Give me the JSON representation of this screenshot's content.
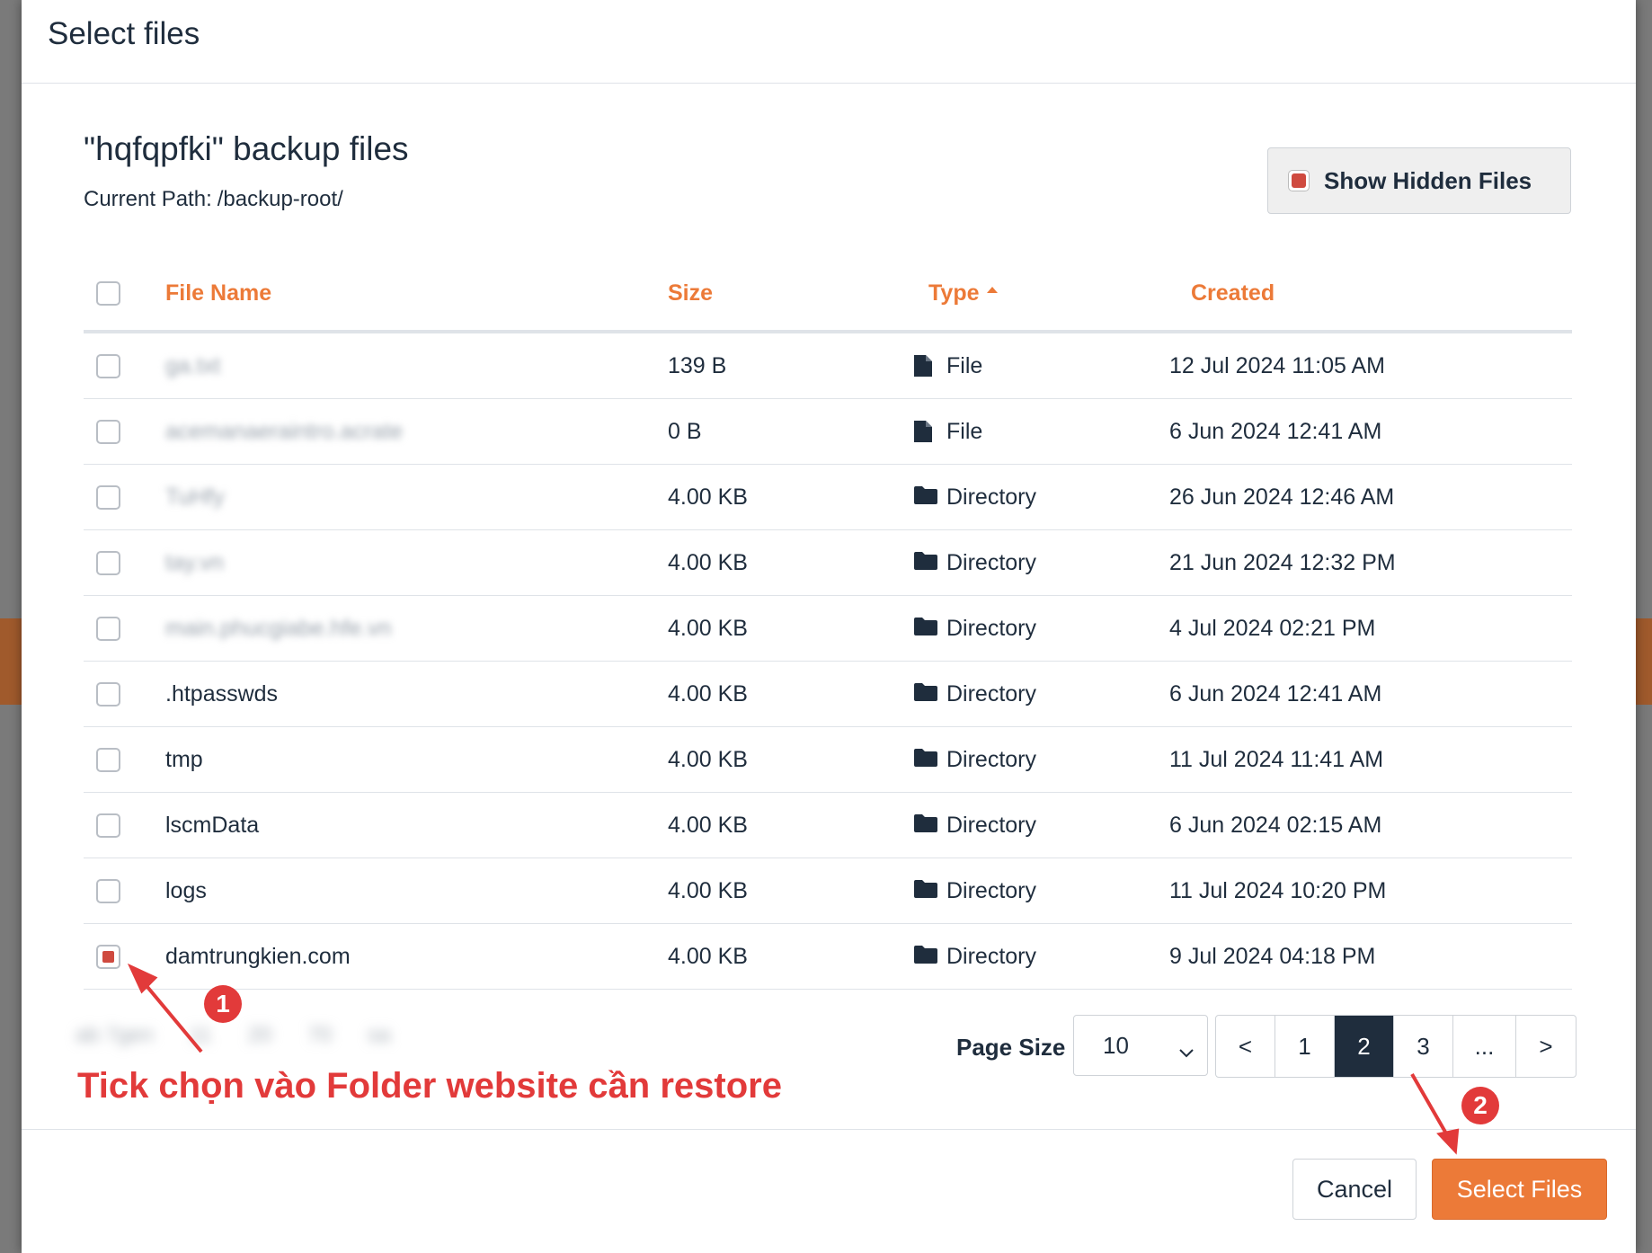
{
  "modal": {
    "title": "Select files"
  },
  "section": {
    "title": "\"hqfqpfki\" backup files",
    "path_label": "Current Path:",
    "path_value": "/backup-root/"
  },
  "toggle": {
    "label": "Show Hidden Files",
    "checked": true
  },
  "table": {
    "headers": {
      "name": "File Name",
      "size": "Size",
      "type": "Type",
      "created": "Created"
    },
    "sort": {
      "column": "Type",
      "direction": "asc"
    },
    "rows": [
      {
        "name": "ga.txt",
        "blurred": true,
        "size": "139 B",
        "type": "File",
        "created": "12 Jul 2024 11:05 AM",
        "checked": false
      },
      {
        "name": "acemanaeraintro.acrate",
        "blurred": true,
        "size": "0 B",
        "type": "File",
        "created": "6 Jun 2024 12:41 AM",
        "checked": false
      },
      {
        "name": "TuHfy",
        "blurred": true,
        "size": "4.00 KB",
        "type": "Directory",
        "created": "26 Jun 2024 12:46 AM",
        "checked": false
      },
      {
        "name": "tay.vn",
        "blurred": true,
        "size": "4.00 KB",
        "type": "Directory",
        "created": "21 Jun 2024 12:32 PM",
        "checked": false
      },
      {
        "name": "main.phucgiabe.hfe.vn",
        "blurred": true,
        "size": "4.00 KB",
        "type": "Directory",
        "created": "4 Jul 2024 02:21 PM",
        "checked": false
      },
      {
        "name": ".htpasswds",
        "blurred": false,
        "size": "4.00 KB",
        "type": "Directory",
        "created": "6 Jun 2024 12:41 AM",
        "checked": false
      },
      {
        "name": "tmp",
        "blurred": false,
        "size": "4.00 KB",
        "type": "Directory",
        "created": "11 Jul 2024 11:41 AM",
        "checked": false
      },
      {
        "name": "lscmData",
        "blurred": false,
        "size": "4.00 KB",
        "type": "Directory",
        "created": "6 Jun 2024 02:15 AM",
        "checked": false
      },
      {
        "name": "logs",
        "blurred": false,
        "size": "4.00 KB",
        "type": "Directory",
        "created": "11 Jul 2024 10:20 PM",
        "checked": false
      },
      {
        "name": "damtrungkien.com",
        "blurred": false,
        "size": "4.00 KB",
        "type": "Directory",
        "created": "9 Jul 2024 04:18 PM",
        "checked": true
      }
    ]
  },
  "footer_blurred": [
    "ab 7gen",
    "11",
    "20",
    "70",
    "sa"
  ],
  "pagination": {
    "page_size_label": "Page Size",
    "page_size": "10",
    "buttons": [
      "<",
      "1",
      "2",
      "3",
      "...",
      ">"
    ],
    "active": "2"
  },
  "annotation": {
    "text": "Tick chọn vào Folder website cần restore",
    "badge1": "1",
    "badge2": "2",
    "color": "#e23a3a"
  },
  "buttons": {
    "cancel": "Cancel",
    "select": "Select Files"
  },
  "colors": {
    "accent": "#ec7a38",
    "dark": "#1f2d3d",
    "check": "#cf4a3f"
  }
}
